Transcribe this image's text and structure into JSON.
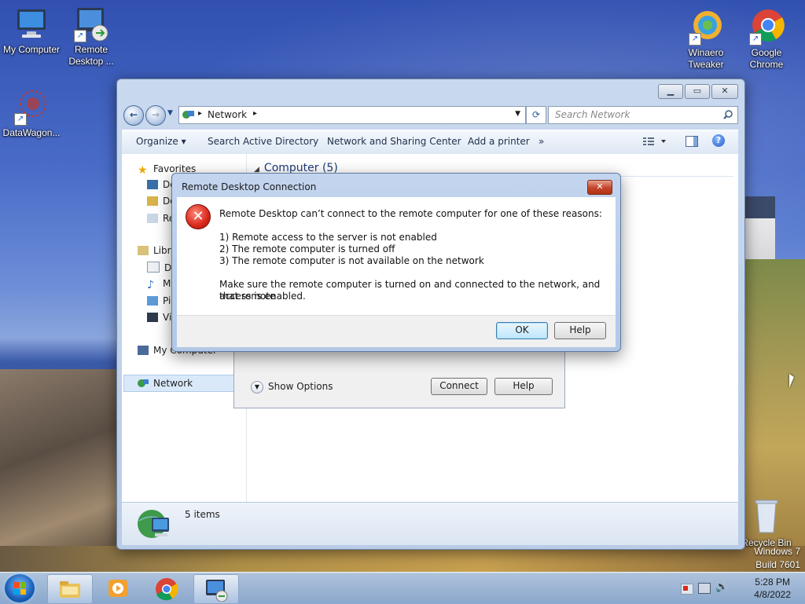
{
  "desktop": {
    "icons": [
      {
        "label": "My Computer"
      },
      {
        "label": "Remote Desktop ..."
      },
      {
        "label": "DataWagon..."
      },
      {
        "label": "Winaero Tweaker"
      },
      {
        "label": "Google Chrome"
      },
      {
        "label": "Recycle Bin"
      }
    ],
    "watermark": {
      "line1": "Windows 7",
      "line2": "Build 7601"
    }
  },
  "explorer": {
    "address": {
      "root": "Network",
      "sep": "▸"
    },
    "search_placeholder": "Search Network",
    "toolbar": {
      "organize": "Organize ▾",
      "search_ad": "Search Active Directory",
      "network_center": "Network and Sharing Center",
      "add_printer": "Add a printer",
      "more": "»"
    },
    "nav_pane": {
      "favorites": "Favorites",
      "fav_items": [
        "De",
        "Do",
        "Re"
      ],
      "libraries": "Libra",
      "lib_items": [
        "Do",
        "M",
        "Pi",
        "Vi"
      ],
      "my_computer": "My Computer",
      "network": "Network"
    },
    "group_header": "Computer (5)",
    "status": {
      "items": "5 items"
    }
  },
  "rdc_dialog_back": {
    "show_options": "Show Options",
    "connect": "Connect",
    "help": "Help"
  },
  "error_dialog": {
    "title": "Remote Desktop Connection",
    "close_glyph": "✕",
    "message": "Remote Desktop can’t connect to the remote computer for one of these reasons:",
    "reasons": [
      "1) Remote access to the server is not enabled",
      "2) The remote computer is turned off",
      "3) The remote computer is not available on the network"
    ],
    "advice_line1": "Make sure the remote computer is turned on and connected to the network, and that remote",
    "advice_line2": "access is enabled.",
    "ok": "OK",
    "help": "Help"
  },
  "taskbar": {
    "time": "5:28 PM",
    "date": "4/8/2022"
  }
}
